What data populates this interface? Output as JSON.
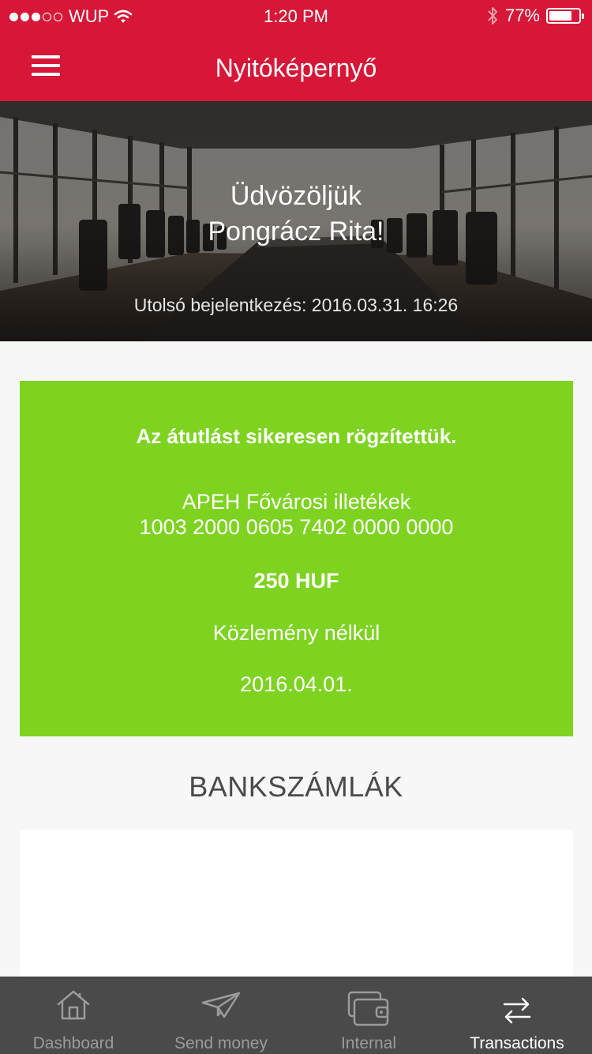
{
  "status_bar": {
    "carrier": "WUP",
    "time": "1:20 PM",
    "battery_text": "77%",
    "battery_level": 0.77,
    "signal_bars_filled": 3,
    "signal_bars_total": 5
  },
  "nav": {
    "title": "Nyitóképernyő"
  },
  "hero": {
    "greeting_line1": "Üdvözöljük",
    "greeting_line2": "Pongrácz Rita!",
    "last_login": "Utolsó bejelentkezés: 2016.03.31. 16:26"
  },
  "success": {
    "title": "Az átutlást sikeresen rögzítettük.",
    "payee": "APEH Fővárosi illetékek",
    "account_number": "1003 2000 0605 7402 0000 0000",
    "amount": "250 HUF",
    "note": "Közlemény nélkül",
    "date": "2016.04.01."
  },
  "accounts": {
    "title": "BANKSZÁMLÁK"
  },
  "tabs": [
    {
      "label": "Dashboard",
      "icon": "home-icon",
      "active": false
    },
    {
      "label": "Send money",
      "icon": "paper-plane-icon",
      "active": false
    },
    {
      "label": "Internal",
      "icon": "wallet-icon",
      "active": false
    },
    {
      "label": "Transactions",
      "icon": "arrows-exchange-icon",
      "active": true
    }
  ],
  "colors": {
    "brand_red": "#d71737",
    "success_green": "#7ed321",
    "tabbar_bg": "#4a4a4a",
    "tab_inactive": "#9b9b9b",
    "tab_active": "#ffffff"
  }
}
